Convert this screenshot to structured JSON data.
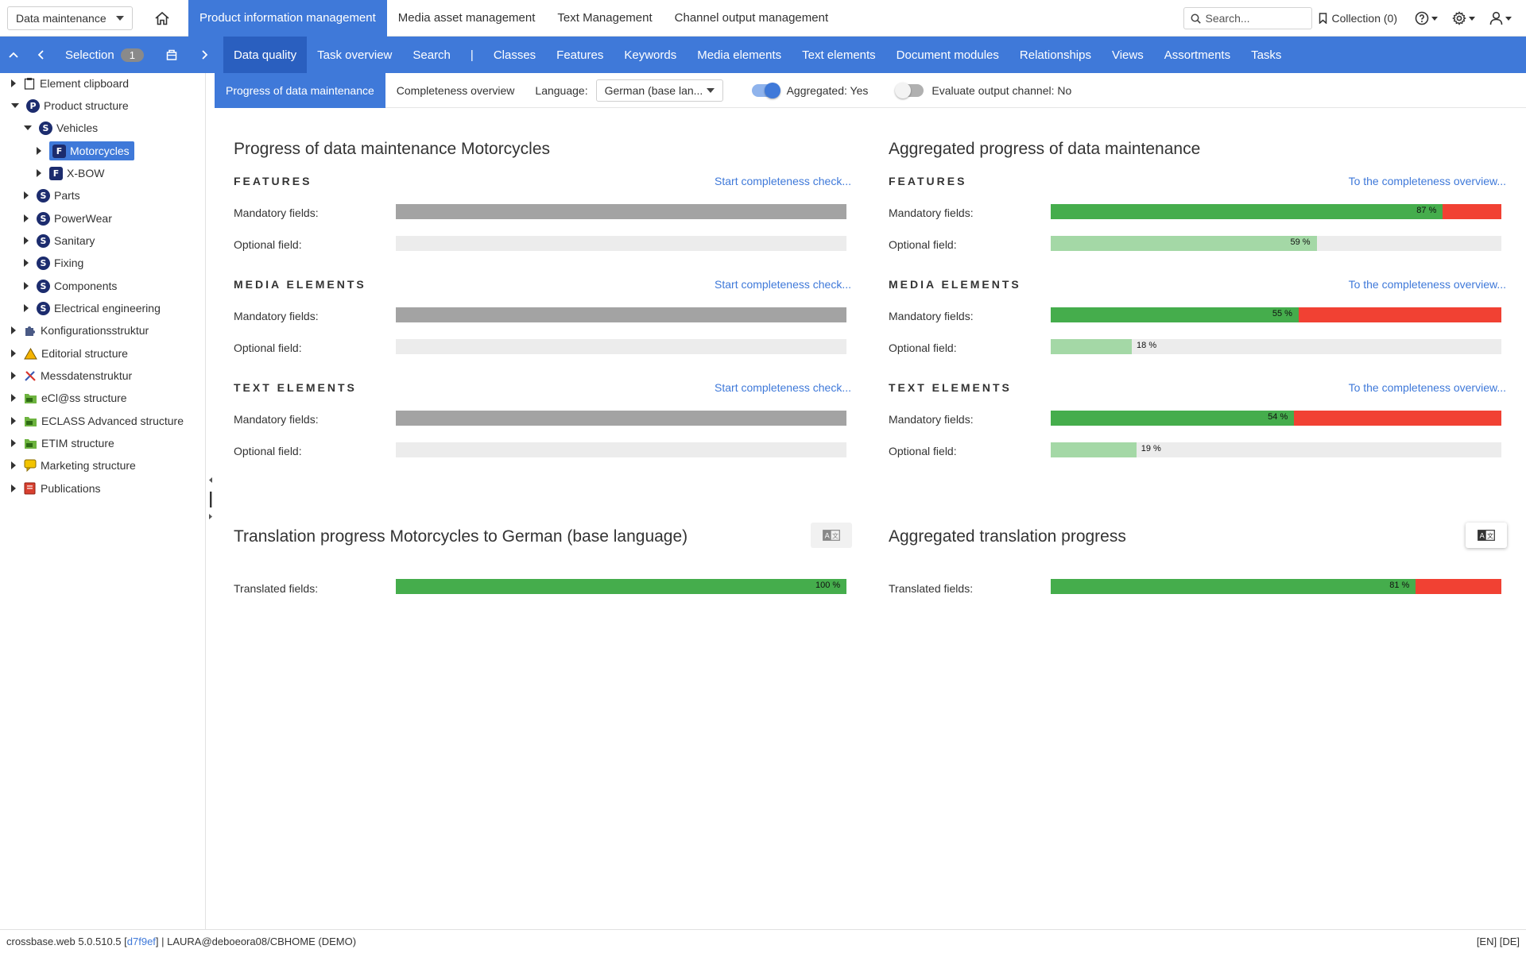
{
  "topbar": {
    "module_select": "Data maintenance",
    "tabs": [
      "Product information management",
      "Media asset management",
      "Text Management",
      "Channel output management"
    ],
    "search_placeholder": "Search...",
    "collection": "Collection (0)"
  },
  "navbar": {
    "selection_label": "Selection",
    "selection_count": "1",
    "items": [
      "Data quality",
      "Task overview",
      "Search",
      "Classes",
      "Features",
      "Keywords",
      "Media elements",
      "Text elements",
      "Document modules",
      "Relationships",
      "Views",
      "Assortments",
      "Tasks"
    ],
    "separator": "|"
  },
  "tree": [
    {
      "label": "Element clipboard",
      "icon": "clipboard-icon"
    },
    {
      "label": "Product structure",
      "icon": "P"
    },
    {
      "label": "Vehicles",
      "icon": "S"
    },
    {
      "label": "Motorcycles",
      "icon": "F"
    },
    {
      "label": "X-BOW",
      "icon": "F"
    },
    {
      "label": "Parts",
      "icon": "S"
    },
    {
      "label": "PowerWear",
      "icon": "S"
    },
    {
      "label": "Sanitary",
      "icon": "S"
    },
    {
      "label": "Fixing",
      "icon": "S"
    },
    {
      "label": "Components",
      "icon": "S"
    },
    {
      "label": "Electrical engineering",
      "icon": "S"
    },
    {
      "label": "Konfigurationsstruktur",
      "icon": "puzzle-icon"
    },
    {
      "label": "Editorial structure",
      "icon": "warning-triangle-icon"
    },
    {
      "label": "Messdatenstruktur",
      "icon": "tools-icon"
    },
    {
      "label": "eCl@ss structure",
      "icon": "eclass-folder-icon"
    },
    {
      "label": "ECLASS Advanced structure",
      "icon": "eclass-folder-icon"
    },
    {
      "label": "ETIM structure",
      "icon": "etim-folder-icon"
    },
    {
      "label": "Marketing structure",
      "icon": "speech-bubble-icon"
    },
    {
      "label": "Publications",
      "icon": "book-icon"
    }
  ],
  "subbar": {
    "tabs": [
      "Progress of data maintenance",
      "Completeness overview"
    ],
    "language_label": "Language:",
    "language_value": "German (base lan...",
    "aggregated_label": "Aggregated: Yes",
    "evaluate_label": "Evaluate output channel: No"
  },
  "labels": {
    "mandatory": "Mandatory fields:",
    "optional": "Optional field:",
    "translated": "Translated fields:",
    "start_check": "Start completeness check...",
    "to_overview": "To the completeness overview..."
  },
  "left_panel": {
    "title": "Progress of data maintenance Motorcycles",
    "sections": [
      "FEATURES",
      "MEDIA ELEMENTS",
      "TEXT ELEMENTS"
    ]
  },
  "right_panel": {
    "title": "Aggregated progress of data maintenance",
    "sections": [
      {
        "name": "FEATURES",
        "mandatory_pct": 87,
        "mandatory_label": "87 %",
        "optional_pct": 59,
        "optional_label": "59 %"
      },
      {
        "name": "MEDIA ELEMENTS",
        "mandatory_pct": 55,
        "mandatory_label": "55 %",
        "optional_pct": 18,
        "optional_label": "18 %"
      },
      {
        "name": "TEXT ELEMENTS",
        "mandatory_pct": 54,
        "mandatory_label": "54 %",
        "optional_pct": 19,
        "optional_label": "19 %"
      }
    ]
  },
  "translation_left": {
    "title": "Translation progress Motorcycles to German (base language)",
    "pct": 100,
    "pct_label": "100 %"
  },
  "translation_right": {
    "title": "Aggregated translation progress",
    "pct": 81,
    "pct_label": "81 %"
  },
  "statusbar": {
    "prefix": "crossbase.web 5.0.510.5 [",
    "commit": "d7f9ef",
    "suffix": "] | LAURA@deboeora08/CBHOME (DEMO)",
    "languages": "[EN] [DE]"
  },
  "colors": {
    "accent": "#3f79d9",
    "progress_green": "#45ad4c",
    "progress_light_green": "#a4d8a6",
    "progress_red": "#f14133",
    "empty_bar": "#ececec",
    "not_checked_bar": "#a3a3a3"
  }
}
